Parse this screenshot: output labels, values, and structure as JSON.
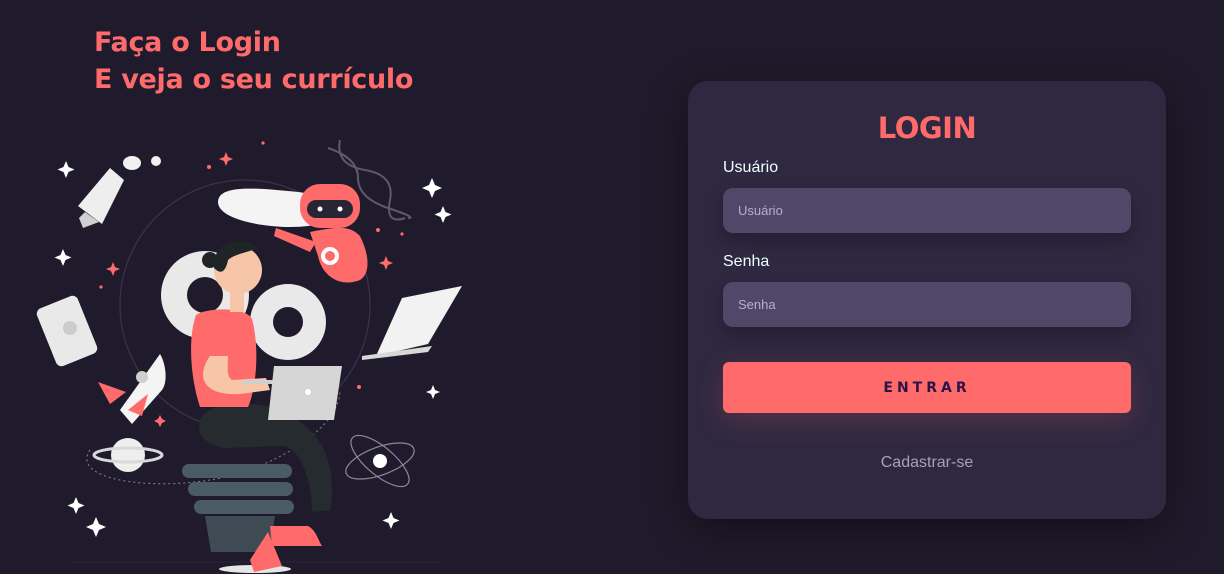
{
  "hero": {
    "line1": "Faça o Login",
    "line2": "E veja o seu currículo"
  },
  "illustration": {
    "name": "person-with-laptop-illustration"
  },
  "login": {
    "title": "LOGIN",
    "username_label": "Usuário",
    "username_placeholder": "Usuário",
    "username_value": "",
    "password_label": "Senha",
    "password_placeholder": "Senha",
    "password_value": "",
    "submit_label": "ENTRAR",
    "register_link": "Cadastrar-se"
  },
  "colors": {
    "background": "#201b2c",
    "card": "#2f2841",
    "input": "#514869",
    "accent": "#ff6b6b",
    "button_text": "#2b134b"
  }
}
